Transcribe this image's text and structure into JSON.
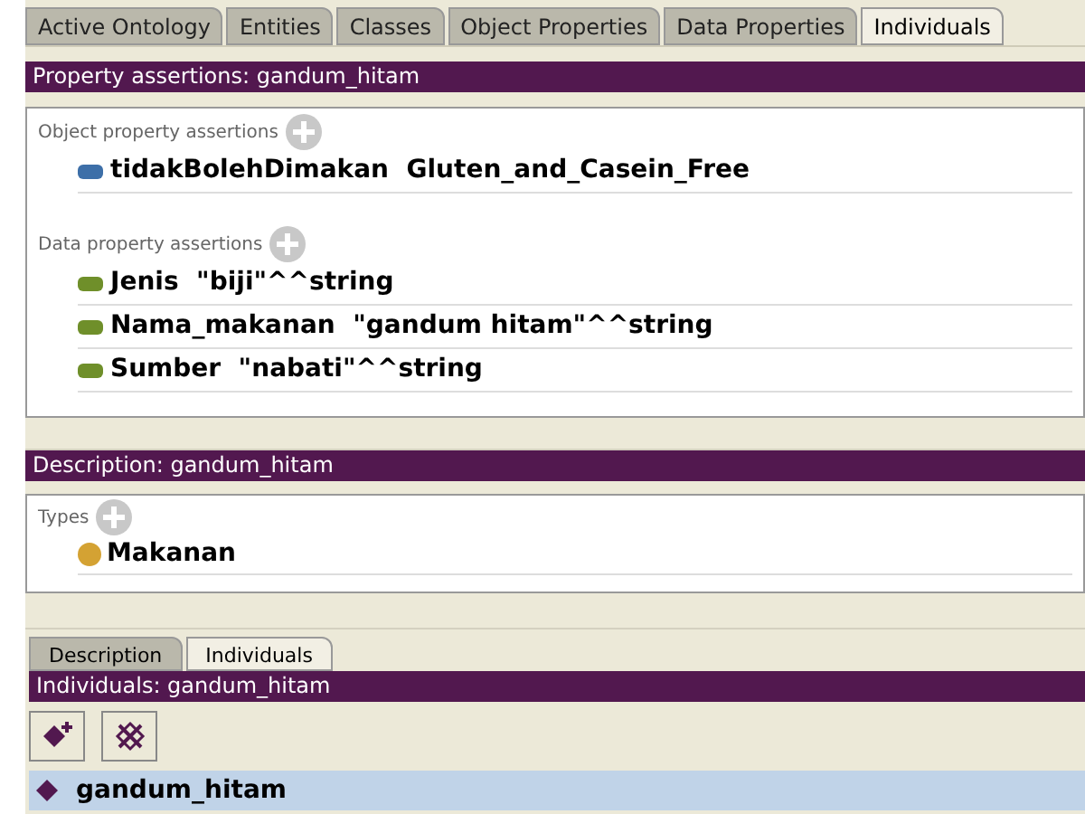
{
  "tabs": [
    {
      "label": "Active Ontology",
      "selected": false
    },
    {
      "label": "Entities",
      "selected": false
    },
    {
      "label": "Classes",
      "selected": false
    },
    {
      "label": "Object Properties",
      "selected": false
    },
    {
      "label": "Data Properties",
      "selected": false
    },
    {
      "label": "Individuals",
      "selected": true
    }
  ],
  "property_assertions": {
    "title": "Property assertions: gandum_hitam",
    "sections": [
      {
        "label": "Object property assertions",
        "items": [
          {
            "kind": "object",
            "property": "tidakBolehDimakan",
            "value": "Gluten_and_Casein_Free"
          }
        ]
      },
      {
        "label": "Data property assertions",
        "items": [
          {
            "kind": "data",
            "property": "Jenis",
            "value": "\"biji\"^^string"
          },
          {
            "kind": "data",
            "property": "Nama_makanan",
            "value": "\"gandum hitam\"^^string"
          },
          {
            "kind": "data",
            "property": "Sumber",
            "value": "\"nabati\"^^string"
          }
        ]
      }
    ]
  },
  "description": {
    "title": "Description: gandum_hitam",
    "types_label": "Types",
    "types": [
      "Makanan"
    ]
  },
  "bottom_tabs": [
    {
      "label": "Description",
      "selected": false
    },
    {
      "label": "Individuals",
      "selected": true
    }
  ],
  "individuals": {
    "title": "Individuals: gandum_hitam",
    "items": [
      {
        "name": "gandum_hitam",
        "selected": true
      }
    ]
  }
}
